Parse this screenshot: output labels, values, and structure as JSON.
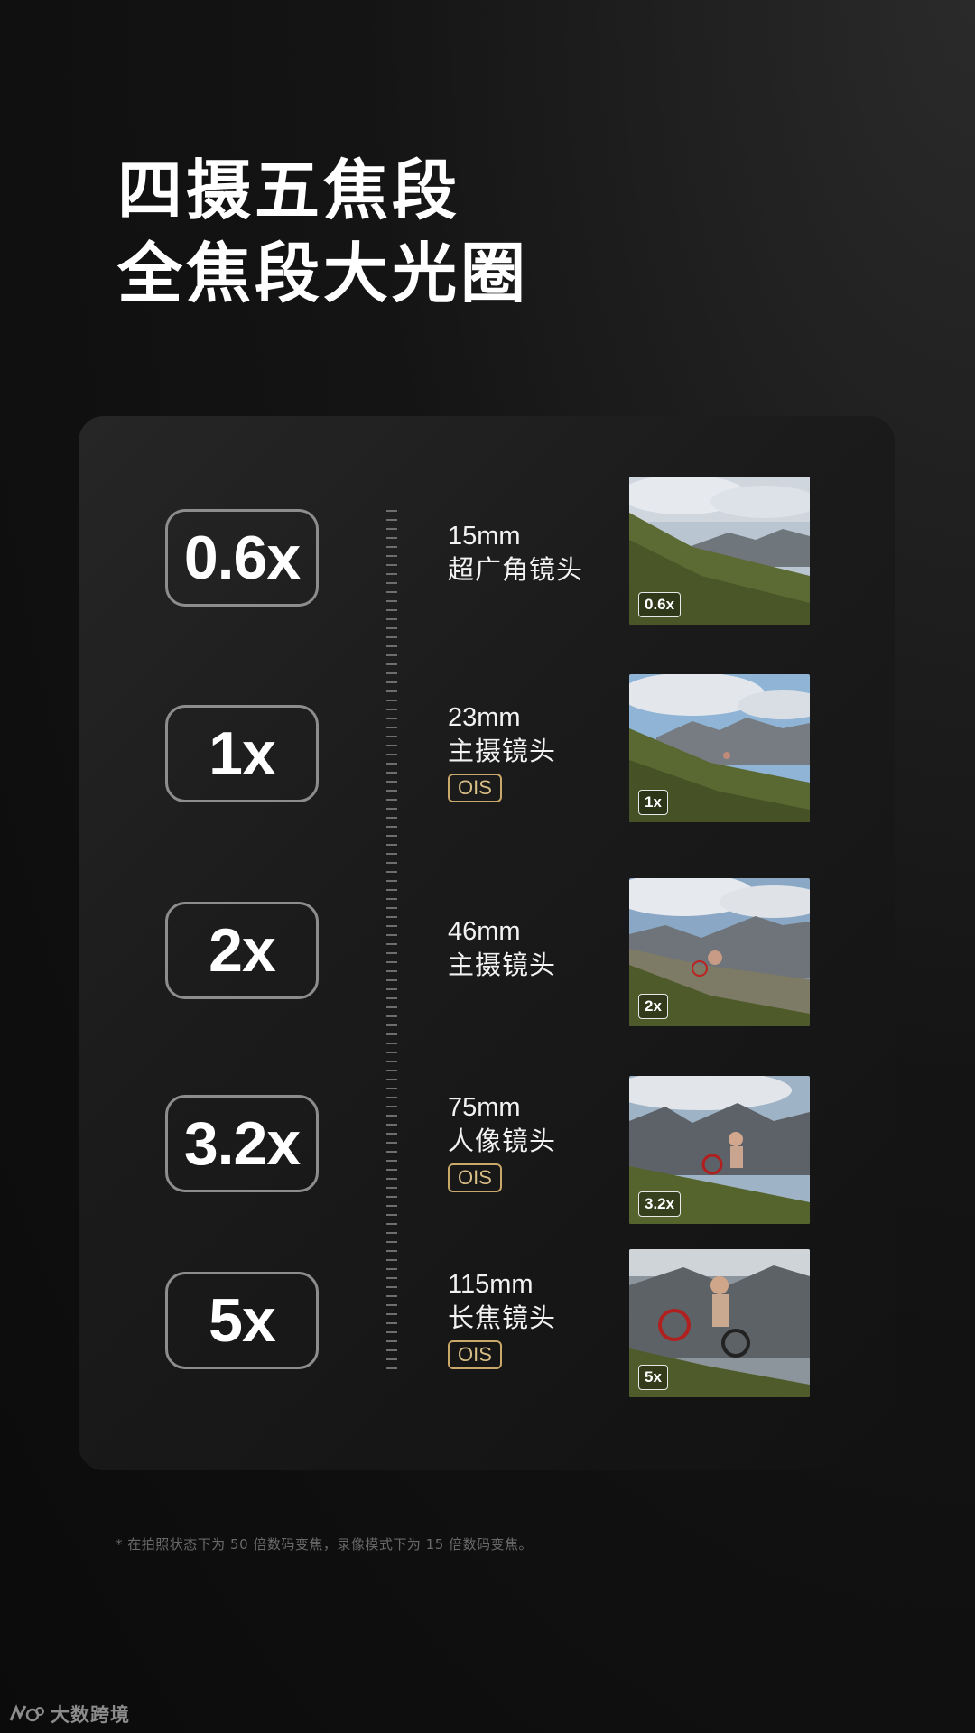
{
  "headline": {
    "line1": "四摄五焦段",
    "line2": "全焦段大光圈"
  },
  "lenses": [
    {
      "zoom": "0.6x",
      "focal": "15mm",
      "lens": "超广角镜头",
      "ois": "",
      "photo_tag": "0.6x"
    },
    {
      "zoom": "1x",
      "focal": "23mm",
      "lens": "主摄镜头",
      "ois": "OIS",
      "photo_tag": "1x"
    },
    {
      "zoom": "2x",
      "focal": "46mm",
      "lens": "主摄镜头",
      "ois": "",
      "photo_tag": "2x"
    },
    {
      "zoom": "3.2x",
      "focal": "75mm",
      "lens": "人像镜头",
      "ois": "OIS",
      "photo_tag": "3.2x"
    },
    {
      "zoom": "5x",
      "focal": "115mm",
      "lens": "长焦镜头",
      "ois": "OIS",
      "photo_tag": "5x"
    }
  ],
  "footnote": "* 在拍照状态下为 50 倍数码变焦，录像模式下为 15 倍数码变焦。",
  "watermark": {
    "text": "大数跨境",
    "logo_icon": "brand-logo-icon"
  },
  "colors": {
    "accent_gold": "#c9a86a",
    "card_bg": "#1b1b1b",
    "page_bg": "#0b0b0b"
  }
}
